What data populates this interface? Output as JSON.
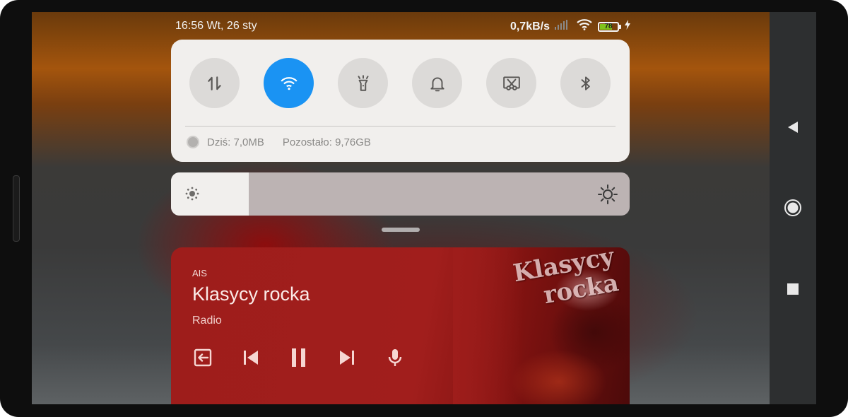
{
  "status_bar": {
    "time_date": "16:56 Wt, 26 sty",
    "net_speed": "0,7kB/s",
    "battery_level": "78",
    "icons": [
      "signal-icon",
      "wifi-icon",
      "battery-icon",
      "charging-icon"
    ]
  },
  "quick_settings": {
    "tiles": [
      {
        "name": "mobile-data",
        "icon": "data-transfer-icon",
        "active": false
      },
      {
        "name": "wifi",
        "icon": "wifi-icon",
        "active": true
      },
      {
        "name": "flashlight",
        "icon": "flashlight-icon",
        "active": false
      },
      {
        "name": "sound",
        "icon": "bell-icon",
        "active": false
      },
      {
        "name": "screenshot",
        "icon": "scissors-screenshot-icon",
        "active": false
      },
      {
        "name": "bluetooth",
        "icon": "bluetooth-icon",
        "active": false
      }
    ],
    "data_usage": {
      "today": "Dziś: 7,0MB",
      "remaining": "Pozostało: 9,76GB"
    }
  },
  "brightness": {
    "level": 0.17
  },
  "media": {
    "app": "AIS",
    "title": "Klasycy rocka",
    "subtitle": "Radio",
    "artwork_text": "Klasycy rocka",
    "controls": [
      "output-switch-icon",
      "previous-icon",
      "pause-icon",
      "next-icon",
      "microphone-icon"
    ]
  },
  "nav_bar": [
    "back-icon",
    "home-icon",
    "recents-icon"
  ],
  "colors": {
    "accent": "#1a93f3",
    "panel": "#f1efed",
    "media_bg": "#9e1d1b",
    "battery": "#7fc41a"
  }
}
